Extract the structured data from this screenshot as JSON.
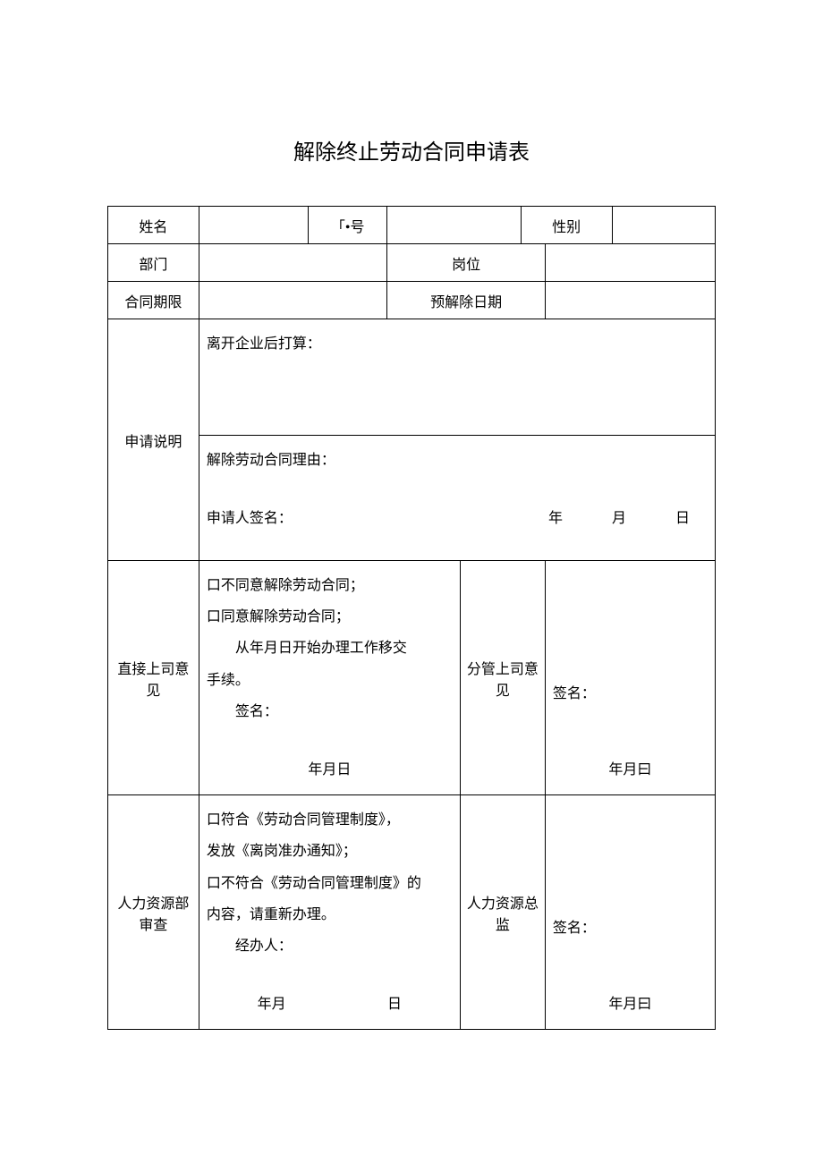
{
  "title": "解除终止劳动合同申请表",
  "row1": {
    "name_label": "姓名",
    "name_value": "",
    "id_label": "「•号",
    "id_value": "",
    "gender_label": "性别",
    "gender_value": ""
  },
  "row2": {
    "dept_label": "部门",
    "dept_value": "",
    "position_label": "岗位",
    "position_value": ""
  },
  "row3": {
    "term_label": "合同期限",
    "term_value": "",
    "pre_date_label": "预解除日期",
    "pre_date_value": ""
  },
  "section_app": {
    "label": "申请说明",
    "plan_label": "离开企业后打算：",
    "reason_label": "解除劳动合同理由：",
    "sign_label": "申请人签名：",
    "year": "年",
    "month": "月",
    "day": "日"
  },
  "section_direct": {
    "label": "直接上司意见",
    "opt1": "口不同意解除劳动合同；",
    "opt2": "口同意解除劳动合同；",
    "opt3_prefix": "从年月日开始办理工作移交",
    "opt3_suffix": "手续。",
    "sign_label": "签名：",
    "date_text": "年月日",
    "right_label": "分管上司意见",
    "right_sign": "签名：",
    "right_date": "年月曰"
  },
  "section_hr": {
    "label": "人力资源部审查",
    "opt1a": "口符合《劳动合同管理制度》，",
    "opt1b": "发放《离岗准办通知》；",
    "opt2a": "口不符合《劳动合同管理制度》的",
    "opt2b": "内容，请重新办理。",
    "handler_label": "经办人：",
    "date_ym": "年月",
    "date_d": "日",
    "right_label": "人力资源总监",
    "right_sign": "签名：",
    "right_date": "年月曰"
  }
}
